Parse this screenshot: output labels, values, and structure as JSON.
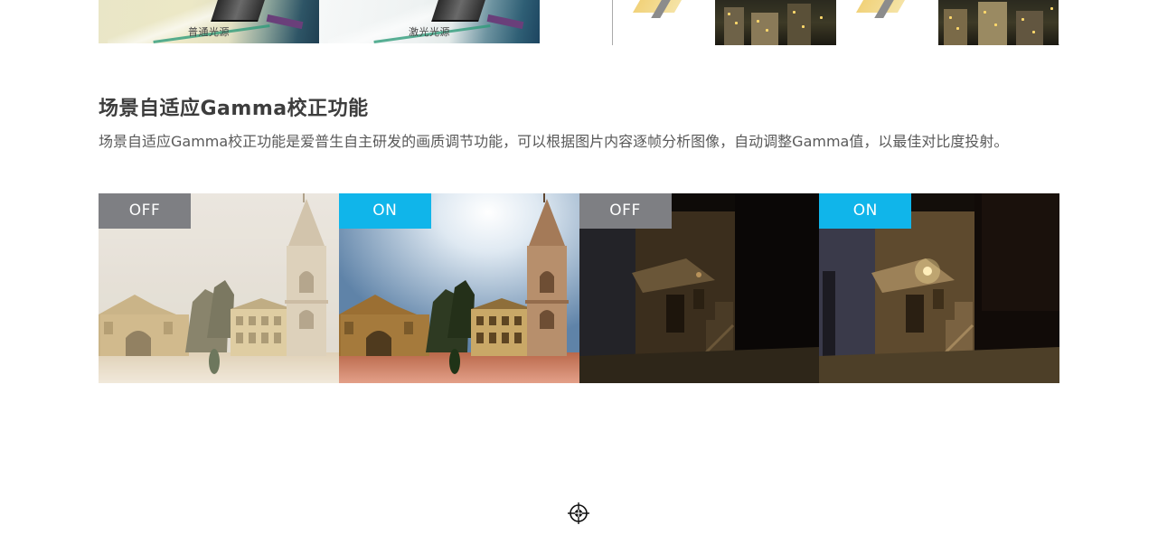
{
  "top_strip": {
    "caption_normal": "普通光源",
    "caption_laser": "激光光源"
  },
  "section": {
    "title": "场景自适应Gamma校正功能",
    "description": "场景自适应Gamma校正功能是爱普生自主研发的画质调节功能，可以根据图片内容逐帧分析图像，自动调整Gamma值，以最佳对比度投射。"
  },
  "panels": [
    {
      "badge": "OFF",
      "state": "off",
      "scene": "church-daylight"
    },
    {
      "badge": "ON",
      "state": "on",
      "scene": "church-daylight"
    },
    {
      "badge": "OFF",
      "state": "off",
      "scene": "alley-night"
    },
    {
      "badge": "ON",
      "state": "on",
      "scene": "alley-night"
    }
  ],
  "colors": {
    "badge_off": "#7e7f83",
    "badge_on": "#10b5ea",
    "title_text": "#3d3d3d",
    "body_text": "#595959"
  },
  "icons": {
    "register_mark": "crosshair-target-icon"
  }
}
